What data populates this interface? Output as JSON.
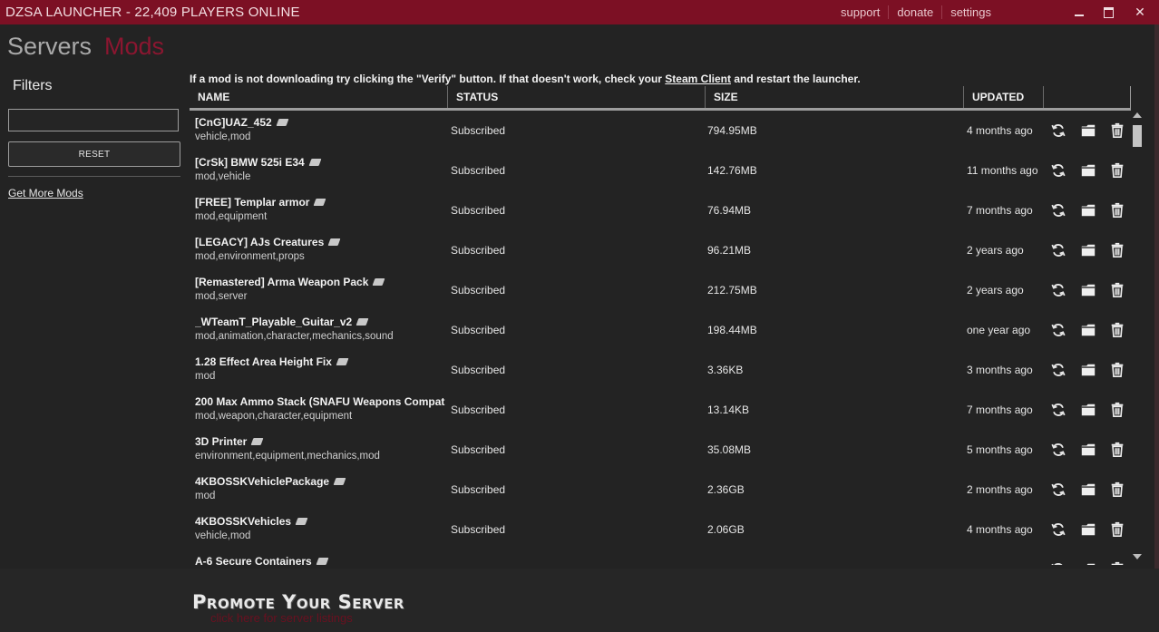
{
  "window": {
    "title": "DZSA LAUNCHER - 22,409 PLAYERS ONLINE",
    "links": [
      "support",
      "donate",
      "settings"
    ],
    "controls": {
      "minimize": "minimize",
      "maximize": "maximize",
      "close": "✕"
    }
  },
  "nav": {
    "servers": "Servers",
    "mods": "Mods",
    "active": "Mods",
    "active_color": "#8b1630"
  },
  "filters": {
    "title": "Filters",
    "search_value": "",
    "reset_label": "RESET",
    "get_more": "Get More Mods"
  },
  "notice": {
    "part1": "If a mod is not downloading try clicking the \"Verify\" button. If that doesn't work, check your ",
    "link": "Steam Client",
    "part2": " and restart the launcher."
  },
  "table": {
    "columns": [
      "NAME",
      "STATUS",
      "SIZE",
      "UPDATED"
    ],
    "rows": [
      {
        "name": "[CnG]UAZ_452",
        "tags": "vehicle,mod",
        "status": "Subscribed",
        "size": "794.95MB",
        "updated": "4 months ago"
      },
      {
        "name": "[CrSk] BMW 525i E34",
        "tags": "mod,vehicle",
        "status": "Subscribed",
        "size": "142.76MB",
        "updated": "11 months ago"
      },
      {
        "name": "[FREE] Templar armor",
        "tags": "mod,equipment",
        "status": "Subscribed",
        "size": "76.94MB",
        "updated": "7 months ago"
      },
      {
        "name": "[LEGACY] AJs Creatures",
        "tags": "mod,environment,props",
        "status": "Subscribed",
        "size": "96.21MB",
        "updated": "2 years ago"
      },
      {
        "name": "[Remastered] Arma Weapon Pack",
        "tags": "mod,server",
        "status": "Subscribed",
        "size": "212.75MB",
        "updated": "2 years ago"
      },
      {
        "name": "_WTeamT_Playable_Guitar_v2",
        "tags": "mod,animation,character,mechanics,sound",
        "status": "Subscribed",
        "size": "198.44MB",
        "updated": "one year ago"
      },
      {
        "name": "1.28 Effect Area Height Fix",
        "tags": "mod",
        "status": "Subscribed",
        "size": "3.36KB",
        "updated": "3 months ago"
      },
      {
        "name": "200 Max Ammo Stack (SNAFU Weapons Compat",
        "tags": "mod,weapon,character,equipment",
        "status": "Subscribed",
        "size": "13.14KB",
        "updated": "7 months ago"
      },
      {
        "name": "3D Printer",
        "tags": "environment,equipment,mechanics,mod",
        "status": "Subscribed",
        "size": "35.08MB",
        "updated": "5 months ago"
      },
      {
        "name": "4KBOSSKVehiclePackage",
        "tags": "mod",
        "status": "Subscribed",
        "size": "2.36GB",
        "updated": "2 months ago"
      },
      {
        "name": "4KBOSSKVehicles",
        "tags": "vehicle,mod",
        "status": "Subscribed",
        "size": "2.06GB",
        "updated": "4 months ago"
      },
      {
        "name": "A-6 Secure Containers",
        "tags": "",
        "status": "",
        "size": "",
        "updated": ""
      }
    ],
    "row_actions": [
      "refresh-icon",
      "folder-icon",
      "trash-icon"
    ]
  },
  "promo": {
    "title": "Promote Your Server",
    "subtitle": "click here for server listings"
  }
}
